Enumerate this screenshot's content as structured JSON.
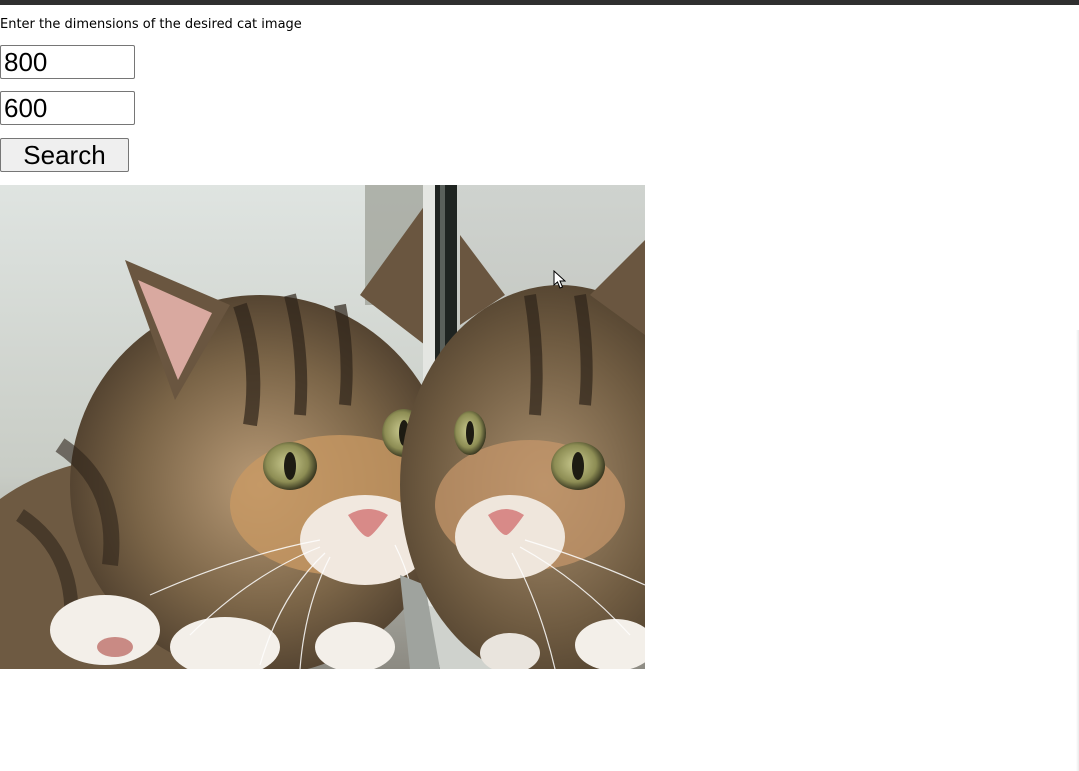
{
  "form": {
    "prompt": "Enter the dimensions of the desired cat image",
    "width_value": "800",
    "height_value": "600",
    "search_label": "Search"
  },
  "colors": {
    "top_bar": "#2f2f2f",
    "button_bg": "#efefef",
    "input_border": "#767676"
  },
  "result": {
    "image_subject": "tabby-kitten-mirror-photo"
  },
  "icons": {
    "cursor": "mouse-pointer-icon"
  }
}
